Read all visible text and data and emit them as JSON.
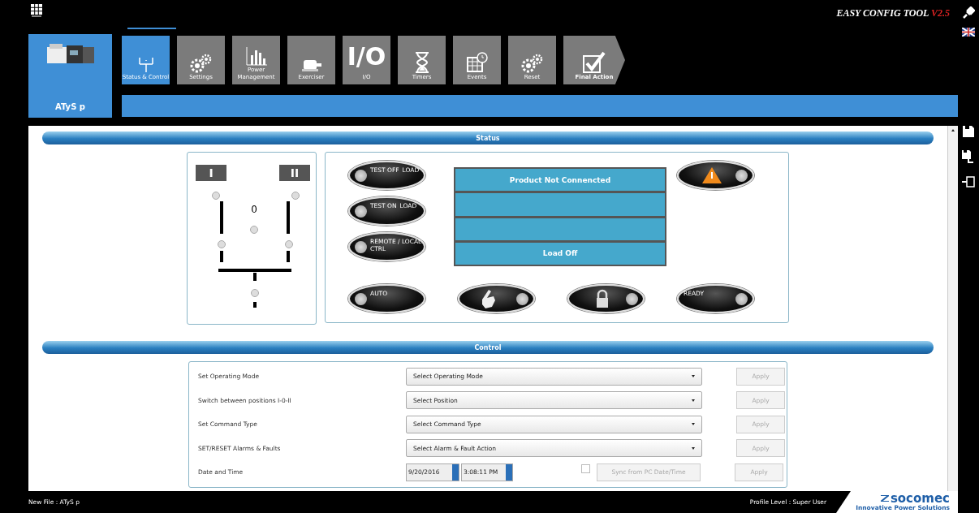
{
  "app": {
    "title": "EASY CONFIG TOOL",
    "version": "V2.5"
  },
  "product": {
    "name": "ATyS p"
  },
  "tabs": [
    {
      "label": "Status & Control",
      "kind": "status",
      "selected": true
    },
    {
      "label": "Settings",
      "kind": "gears",
      "selected": false
    },
    {
      "label": "Power Management",
      "kind": "chart",
      "selected": false
    },
    {
      "label": "Exerciser",
      "kind": "motor",
      "selected": false
    },
    {
      "label": "I/O",
      "kind": "text",
      "icon_text": "I/O",
      "selected": false
    },
    {
      "label": "Timers",
      "kind": "hourglass",
      "selected": false
    },
    {
      "label": "Events",
      "kind": "calendar",
      "selected": false
    },
    {
      "label": "Reset",
      "kind": "gears",
      "selected": false
    },
    {
      "label": "Final Action",
      "kind": "check",
      "selected": false
    }
  ],
  "status": {
    "title": "Status",
    "diagram": {
      "source_1": "I",
      "source_2": "II",
      "zero": "0"
    },
    "side_buttons": [
      {
        "kind": "text",
        "labels": [
          "TEST OFF",
          "LOAD"
        ]
      },
      {
        "kind": "text",
        "labels": [
          "TEST ON",
          "LOAD"
        ]
      },
      {
        "kind": "text",
        "labels": [
          "REMOTE / LOCAL CTRL"
        ]
      }
    ],
    "warning_button": {
      "kind": "warning"
    },
    "bottom_buttons": [
      {
        "kind": "text",
        "labels": [
          "AUTO"
        ]
      },
      {
        "kind": "hand"
      },
      {
        "kind": "lock"
      },
      {
        "kind": "text_right",
        "labels": [
          "READY"
        ]
      }
    ],
    "display_lines": [
      {
        "kind": "text",
        "text": "Product Not Connencted"
      },
      {
        "kind": "blank"
      },
      {
        "kind": "blank"
      },
      {
        "kind": "text",
        "text": "Load Off"
      }
    ]
  },
  "control": {
    "title": "Control",
    "rows": [
      {
        "kind": "select",
        "label": "Set Operating Mode",
        "placeholder": "Select Operating Mode",
        "apply": "Apply",
        "apply_disabled": true
      },
      {
        "kind": "select",
        "label": "Switch between positions I-0-II",
        "placeholder": "Select Position",
        "apply": "Apply",
        "apply_disabled": true
      },
      {
        "kind": "select",
        "label": "Set Command Type",
        "placeholder": "Select Command Type",
        "apply": "Apply",
        "apply_disabled": true
      },
      {
        "kind": "select",
        "label": "SET/RESET Alarms & Faults",
        "placeholder": "Select Alarm & Fault Action",
        "apply": "Apply",
        "apply_disabled": true
      },
      {
        "kind": "datetime",
        "label": "Date and Time",
        "date": "9/20/2016",
        "time": "3:08:11 PM",
        "sync_checked": false,
        "sync": "Sync from PC Date/Time",
        "sync_disabled": true,
        "apply": "Apply",
        "apply_disabled": true
      }
    ]
  },
  "footer": {
    "file": "New File : ATyS p",
    "profile": "Profile Level : Super User",
    "brand": "socomec",
    "tagline": "Innovative Power Solutions"
  }
}
